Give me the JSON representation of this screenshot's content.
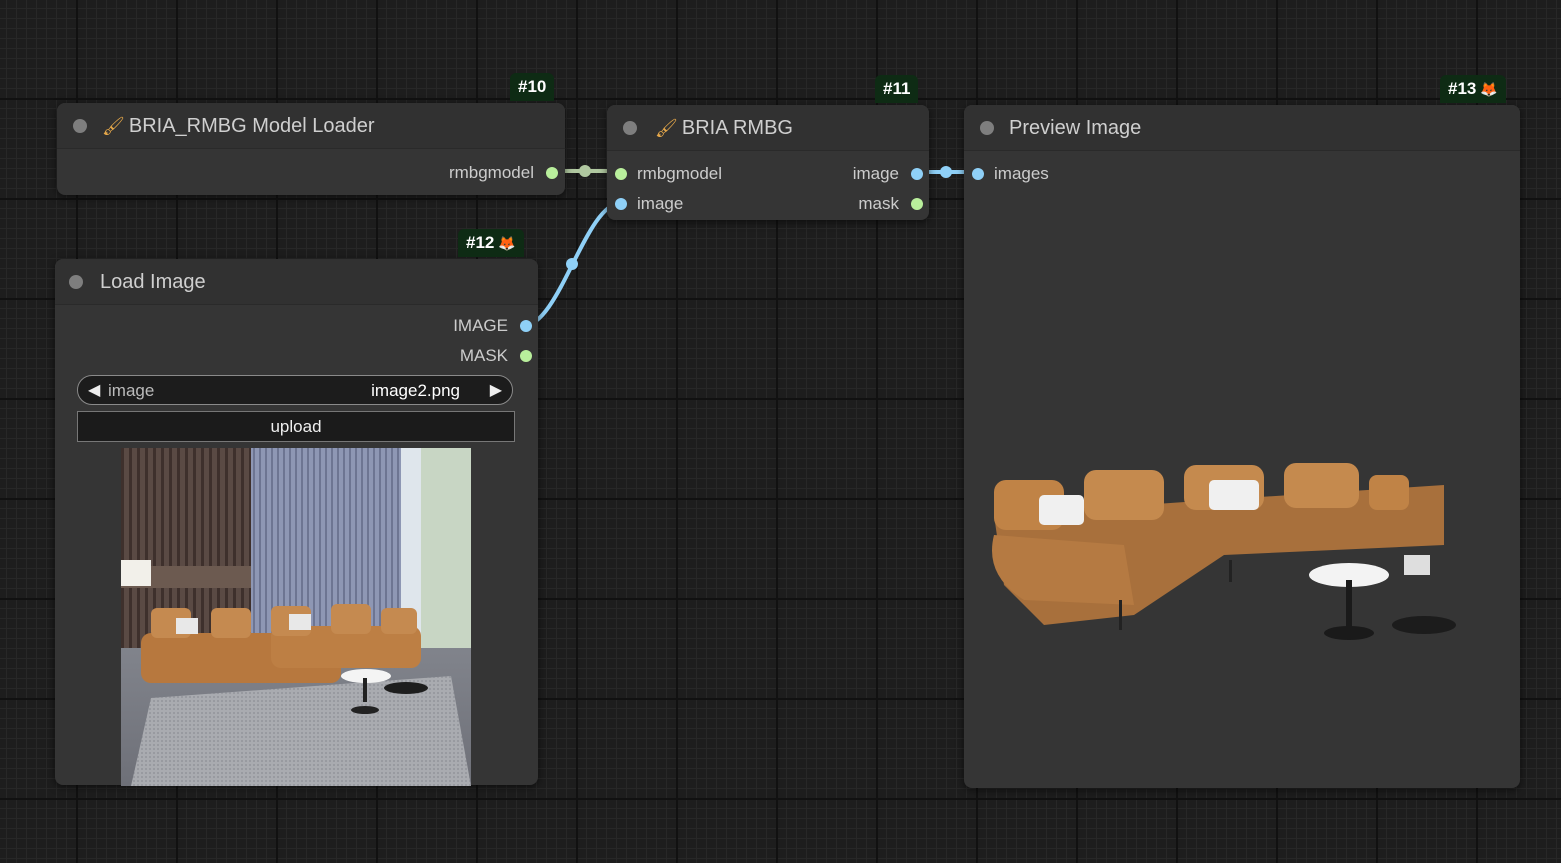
{
  "nodes": {
    "model_loader": {
      "id_badge": "#10",
      "title": "BRIA_RMBG Model Loader",
      "outputs": [
        "rmbgmodel"
      ]
    },
    "rmbg": {
      "id_badge": "#11",
      "title": "BRIA RMBG",
      "inputs": [
        "rmbgmodel",
        "image"
      ],
      "outputs": [
        "image",
        "mask"
      ]
    },
    "load_image": {
      "id_badge": "#12",
      "title": "Load Image",
      "outputs": [
        "IMAGE",
        "MASK"
      ],
      "image_combo": {
        "label": "image",
        "value": "image2.png"
      },
      "upload_label": "upload"
    },
    "preview": {
      "id_badge": "#13",
      "title": "Preview Image",
      "inputs": [
        "images"
      ]
    }
  },
  "icons": {
    "node_header_brush": "paint-brush-icon",
    "badge_mascot": "fox-icon",
    "combo_prev": "triangle-left-icon",
    "combo_next": "triangle-right-icon"
  },
  "colors": {
    "canvas": "#1d1d1d",
    "node_body": "#353535",
    "badge_bg": "#0e2b14",
    "model_wire": "#b9ef9c",
    "image_wire": "#8fd0f7",
    "brush": "#e6a84a"
  }
}
